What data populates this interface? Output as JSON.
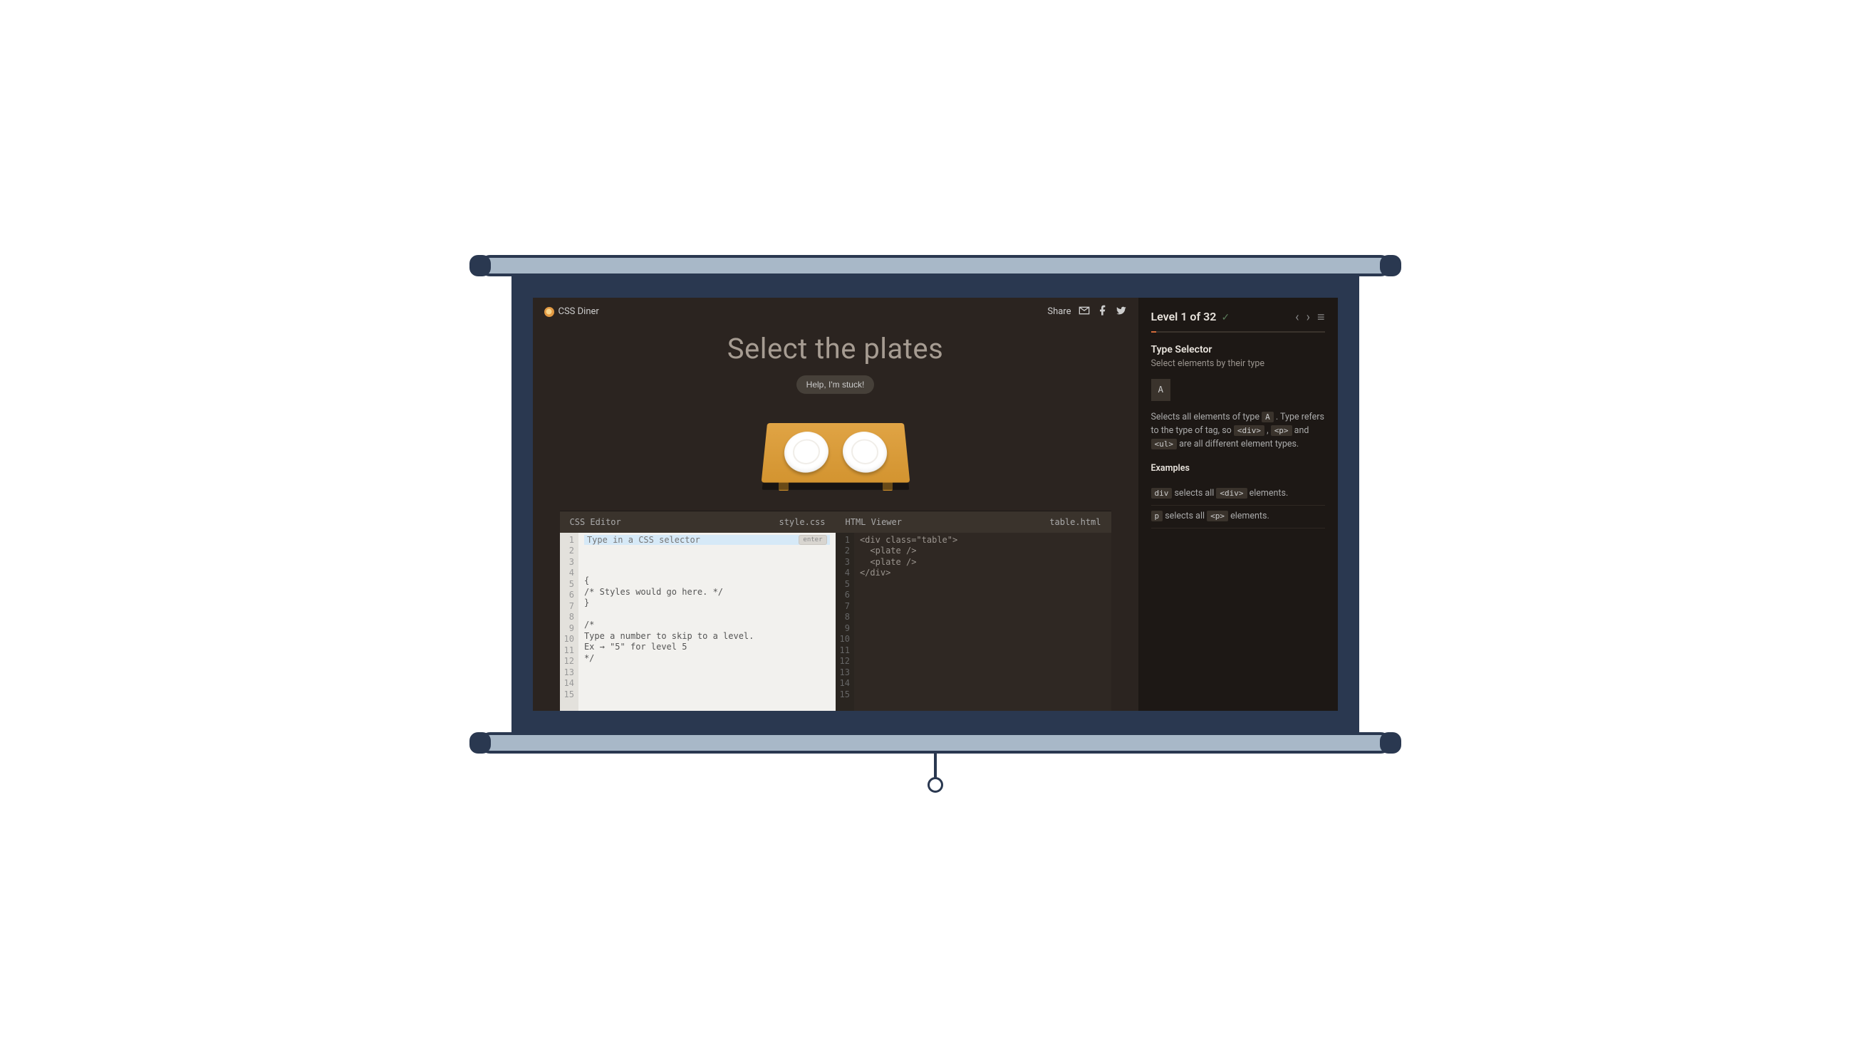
{
  "header": {
    "app_name": "CSS Diner",
    "share_label": "Share"
  },
  "title": "Select the plates",
  "help_button": "Help, I'm stuck!",
  "css_editor": {
    "title": "CSS Editor",
    "filename": "style.css",
    "placeholder": "Type in a CSS selector",
    "enter_label": "enter",
    "lines": [
      "",
      "{",
      "/* Styles would go here. */",
      "}",
      "",
      "/*",
      "Type a number to skip to a level.",
      "Ex → \"5\" for level 5",
      "*/",
      "",
      "",
      "",
      "",
      "",
      ""
    ]
  },
  "html_viewer": {
    "title": "HTML Viewer",
    "filename": "table.html",
    "lines": [
      "<div class=\"table\">",
      "  <plate />",
      "  <plate />",
      "</div>",
      "",
      "",
      "",
      "",
      "",
      "",
      "",
      "",
      "",
      "",
      ""
    ]
  },
  "line_numbers": [
    "1",
    "2",
    "3",
    "4",
    "5",
    "6",
    "7",
    "8",
    "9",
    "10",
    "11",
    "12",
    "13",
    "14",
    "15"
  ],
  "sidebar": {
    "level_label": "Level 1 of 32",
    "heading": "Type Selector",
    "subheading": "Select elements by their type",
    "selector_box": "A",
    "description_pre": "Selects all elements of type ",
    "code_a": "A",
    "description_mid": " . Type refers to the type of tag, so ",
    "code_div": "<div>",
    "sep1": " , ",
    "code_p": "<p>",
    "sep_and": " and ",
    "code_ul": "<ul>",
    "description_post": " are all different element types.",
    "examples_label": "Examples",
    "ex1_code": "div",
    "ex1_mid": " selects all ",
    "ex1_code2": "<div>",
    "ex1_post": " elements.",
    "ex2_code": "p",
    "ex2_mid": " selects all ",
    "ex2_code2": "<p>",
    "ex2_post": " elements."
  }
}
